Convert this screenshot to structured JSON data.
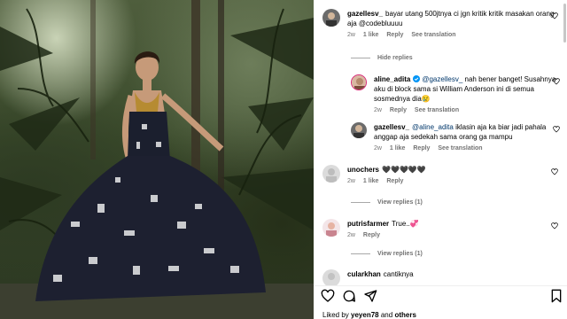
{
  "comments": [
    {
      "username": "gazellesv_",
      "text": "bayar utang 500jtnya ci jgn kritik kritik masakan orang aja @codebluuuu",
      "time": "2w",
      "likes": "1 like",
      "reply": "Reply",
      "translate": "See translation"
    }
  ],
  "hide_replies": "Hide replies",
  "replies": [
    {
      "username": "aline_adita",
      "mention": "@gazellesv_",
      "text": "nah bener banget! Susahnya aku di block sama si William Anderson ini di semua sosmednya dia😢",
      "time": "2w",
      "reply": "Reply",
      "translate": "See translation"
    },
    {
      "username": "gazellesv_",
      "mention": "@aline_adita",
      "text": "iklasin aja ka biar jadi pahala anggap aja sedekah sama orang ga mampu",
      "time": "2w",
      "likes": "1 like",
      "reply": "Reply",
      "translate": "See translation"
    }
  ],
  "comment2": {
    "username": "unochers",
    "text": "🖤🖤🖤🖤🖤",
    "time": "2w",
    "likes": "1 like",
    "reply": "Reply"
  },
  "view_replies_1": "View replies (1)",
  "comment3": {
    "username": "putrisfarmer",
    "text": "True..💞",
    "time": "2w",
    "reply": "Reply"
  },
  "view_replies_2": "View replies (1)",
  "comment4": {
    "username": "cularkhan",
    "text": "cantiknya"
  },
  "likes_bar": {
    "prefix": "Liked by",
    "user": "yeyen78",
    "and": "and",
    "others": "others"
  },
  "icons": [
    "heart-icon",
    "comment-icon",
    "share-icon",
    "bookmark-icon"
  ]
}
